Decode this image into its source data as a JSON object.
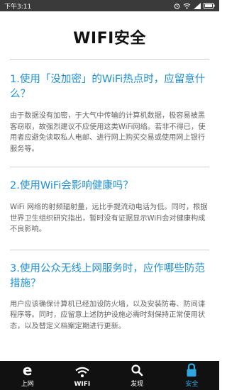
{
  "status_bar": {
    "time": "下午3:11"
  },
  "page_title": "WIFI安全",
  "sections": [
    {
      "question": "1.使用「没加密」的WiFi热点时，应留意什么？",
      "answer": "由于数据没有加密，于大气中传输的计算机数据，极容易被黑客窃取，故强烈建议不应使用这类WiFi网络。若非不得已，使用者应避免读取私人电邮、进行网上购买交易或使用网上银行服务等。"
    },
    {
      "question": "2.使用WiFi会影响健康吗？",
      "answer": "WiFi 网络的射频辐射量，远比手提流动电话为低。同时，根据世界卫生组织研究指出，暂时没有证据显示WiFi会对健康构成不良影响。"
    },
    {
      "question": "3.使用公众无线上网服务时，应作哪些防范措施？",
      "answer": "用户应该确保计算机已经加设防火墙，以及安装防毒、防间谍程序等。同时，应留意上述防护设施必需时刻保持正常使用状态，以及替定义档案定期进行更新。"
    }
  ],
  "tabs": [
    {
      "label": "上网",
      "icon": "browser-e-icon",
      "active": false
    },
    {
      "label": "WIFI",
      "icon": "wifi-icon",
      "active": false
    },
    {
      "label": "发现",
      "icon": "search-icon",
      "active": false
    },
    {
      "label": "安全",
      "icon": "lock-icon",
      "active": true
    }
  ],
  "colors": {
    "accent": "#2fa8e0",
    "question_text": "#1f8fd0",
    "tab_bar_bg": "#111111",
    "status_bar_bg": "#3a3a3a"
  }
}
